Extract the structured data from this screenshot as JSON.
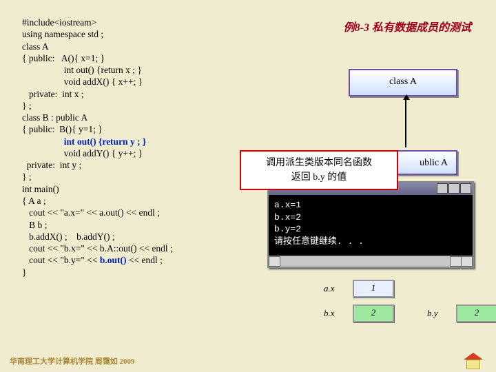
{
  "title": "例8-3  私有数据成员的测试",
  "code": {
    "l1": "#include<iostream>",
    "l2": "using namespace std ;",
    "l3": "class A",
    "l4": "{ public:   A(){ x=1; }",
    "l5": "                  int out() {return x ; }",
    "l6": "                  void addX() { x++; }",
    "l7": "   private:  int x ;",
    "l8": "} ;",
    "l9": "class B : public A",
    "l10": "{ public:  B(){ y=1; }",
    "l11a": "                  ",
    "l11b": "int out() {return y ; }",
    "l12": "                  void addY() { y++; }",
    "l13": "  private:  int y ;",
    "l14": "} ;",
    "l15": "int main()",
    "l16": "{ A a ;",
    "l17": "   cout << \"a.x=\" << a.out() << endl ;",
    "l18": "   B b ;",
    "l19": "   b.addX() ;    b.addY() ;",
    "l20": "   cout << \"b.x=\" << b.A::out() << endl ;",
    "l21a": "   cout << \"b.y=\" << ",
    "l21b": "b.out()",
    "l21c": " << endl ;",
    "l22": "}"
  },
  "boxA": "class  A",
  "boxB": "ublic  A",
  "callout": {
    "l1": "调用派生类版本同名函数",
    "l2": "返回 b.y 的值"
  },
  "console": {
    "l1": "a.x=1",
    "l2": "b.x=2",
    "l3": "b.y=2",
    "l4": "请按任意键继续. . ."
  },
  "vars": {
    "ax": {
      "lbl": "a.x",
      "val": "1"
    },
    "bx": {
      "lbl": "b.x",
      "val": "2"
    },
    "by": {
      "lbl": "b.y",
      "val": "2"
    }
  },
  "footer": "华南理工大学计算机学院 周霭如 2009"
}
